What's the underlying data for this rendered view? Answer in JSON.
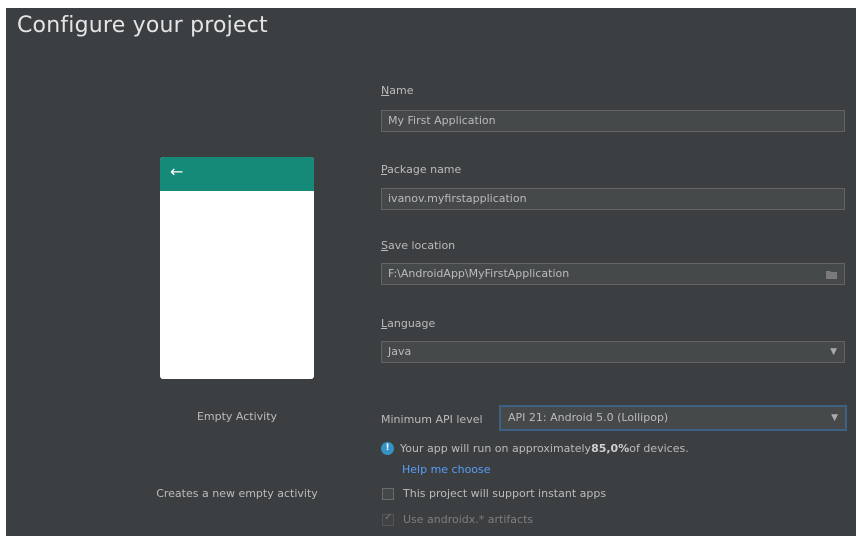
{
  "window": {
    "title": "Configure your project"
  },
  "template": {
    "back_arrow": "←",
    "name": "Empty Activity",
    "description": "Creates a new empty activity"
  },
  "form": {
    "name": {
      "mnemonic": "N",
      "rest": "ame",
      "value": "My First Application"
    },
    "package": {
      "mnemonic": "P",
      "rest": "ackage name",
      "value": "ivanov.myfirstapplication"
    },
    "save_location": {
      "mnemonic": "S",
      "rest": "ave location",
      "value": "F:\\AndroidApp\\MyFirstApplication",
      "icon": "folder-icon"
    },
    "language": {
      "mnemonic": "L",
      "rest": "anguage",
      "value": "Java"
    },
    "min_api": {
      "label": "Minimum API level",
      "value": "API 21: Android 5.0 (Lollipop)"
    }
  },
  "info": {
    "icon": "!",
    "text_before": "Your app will run on approximately ",
    "percent": "85,0%",
    "text_after": " of devices.",
    "help_link": "Help me choose"
  },
  "checkboxes": {
    "instant_apps": {
      "label": "This project will support instant apps",
      "checked": false,
      "enabled": true
    },
    "androidx": {
      "label": "Use androidx.* artifacts",
      "checked": true,
      "enabled": false
    }
  },
  "colors": {
    "background": "#3c3f41",
    "field": "#45494a",
    "accent_appbar": "#158a78",
    "link": "#589df6",
    "focus_border": "#3d6185"
  }
}
